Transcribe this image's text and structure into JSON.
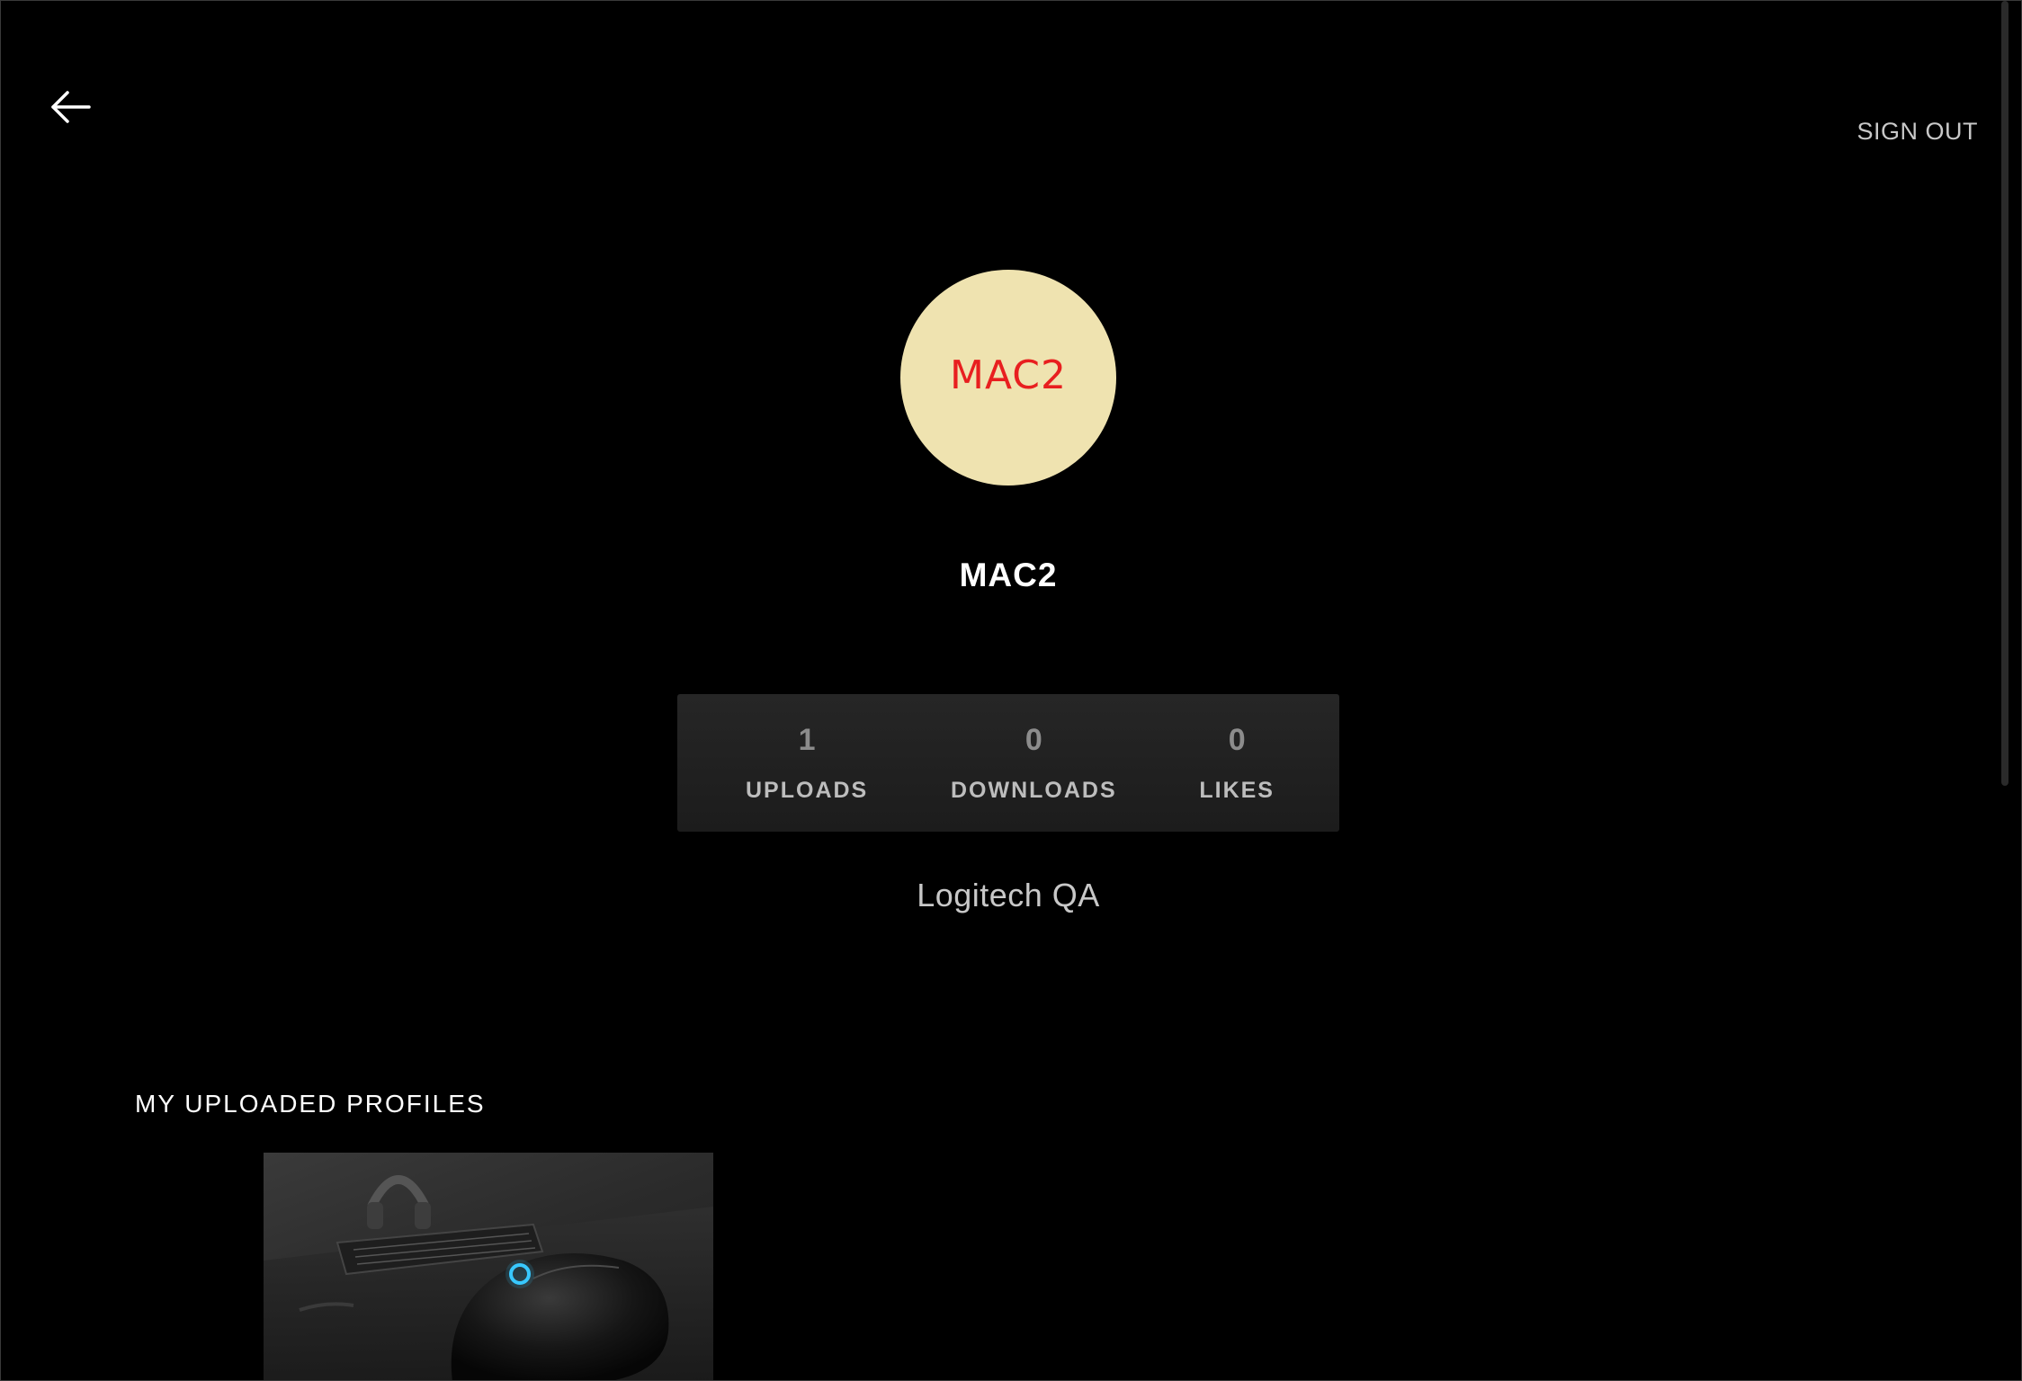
{
  "header": {
    "back_icon": "arrow-left-icon",
    "sign_out_label": "SIGN OUT"
  },
  "profile": {
    "avatar_text": "MAC2",
    "avatar_bg": "#efe3b0",
    "avatar_text_color": "#e81f1f",
    "username": "MAC2",
    "affiliation": "Logitech QA"
  },
  "stats": [
    {
      "value": "1",
      "label": "UPLOADS"
    },
    {
      "value": "0",
      "label": "DOWNLOADS"
    },
    {
      "value": "0",
      "label": "LIKES"
    }
  ],
  "uploaded_profiles": {
    "title": "MY UPLOADED PROFILES"
  }
}
